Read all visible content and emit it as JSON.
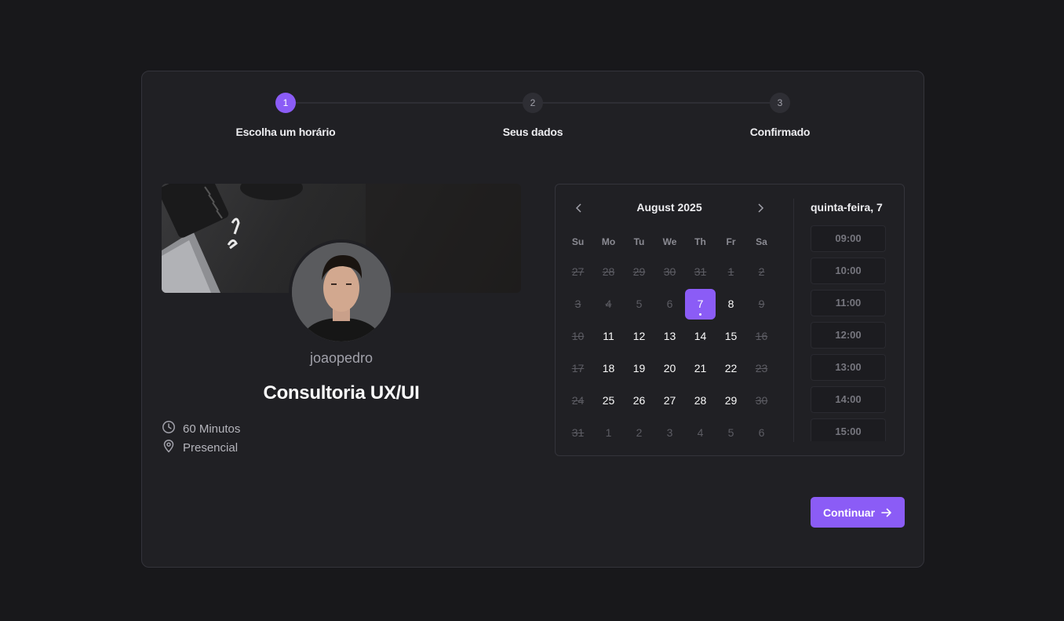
{
  "stepper": {
    "steps": [
      {
        "number": "1",
        "label": "Escolha um horário",
        "active": true
      },
      {
        "number": "2",
        "label": "Seus dados",
        "active": false
      },
      {
        "number": "3",
        "label": "Confirmado",
        "active": false
      }
    ]
  },
  "profile": {
    "username": "joaopedro",
    "service_title": "Consultoria UX/UI",
    "duration": "60 Minutos",
    "location": "Presencial"
  },
  "calendar": {
    "month_label": "August 2025",
    "weekdays": [
      "Su",
      "Mo",
      "Tu",
      "We",
      "Th",
      "Fr",
      "Sa"
    ],
    "weeks": [
      [
        {
          "d": "27",
          "s": "disabled"
        },
        {
          "d": "28",
          "s": "disabled"
        },
        {
          "d": "29",
          "s": "disabled"
        },
        {
          "d": "30",
          "s": "disabled"
        },
        {
          "d": "31",
          "s": "disabled"
        },
        {
          "d": "1",
          "s": "disabled"
        },
        {
          "d": "2",
          "s": "disabled"
        }
      ],
      [
        {
          "d": "3",
          "s": "disabled"
        },
        {
          "d": "4",
          "s": "disabled"
        },
        {
          "d": "5",
          "s": "outside"
        },
        {
          "d": "6",
          "s": "outside"
        },
        {
          "d": "7",
          "s": "selected"
        },
        {
          "d": "8",
          "s": "available"
        },
        {
          "d": "9",
          "s": "disabled"
        }
      ],
      [
        {
          "d": "10",
          "s": "disabled"
        },
        {
          "d": "11",
          "s": "available"
        },
        {
          "d": "12",
          "s": "available"
        },
        {
          "d": "13",
          "s": "available"
        },
        {
          "d": "14",
          "s": "available"
        },
        {
          "d": "15",
          "s": "available"
        },
        {
          "d": "16",
          "s": "disabled"
        }
      ],
      [
        {
          "d": "17",
          "s": "disabled"
        },
        {
          "d": "18",
          "s": "available"
        },
        {
          "d": "19",
          "s": "available"
        },
        {
          "d": "20",
          "s": "available"
        },
        {
          "d": "21",
          "s": "available"
        },
        {
          "d": "22",
          "s": "available"
        },
        {
          "d": "23",
          "s": "disabled"
        }
      ],
      [
        {
          "d": "24",
          "s": "disabled"
        },
        {
          "d": "25",
          "s": "available"
        },
        {
          "d": "26",
          "s": "available"
        },
        {
          "d": "27",
          "s": "available"
        },
        {
          "d": "28",
          "s": "available"
        },
        {
          "d": "29",
          "s": "available"
        },
        {
          "d": "30",
          "s": "disabled"
        }
      ],
      [
        {
          "d": "31",
          "s": "disabled"
        },
        {
          "d": "1",
          "s": "outside"
        },
        {
          "d": "2",
          "s": "outside"
        },
        {
          "d": "3",
          "s": "outside"
        },
        {
          "d": "4",
          "s": "outside"
        },
        {
          "d": "5",
          "s": "outside"
        },
        {
          "d": "6",
          "s": "outside"
        }
      ]
    ]
  },
  "times": {
    "date_label": "quinta-feira, 7",
    "slots": [
      "09:00",
      "10:00",
      "11:00",
      "12:00",
      "13:00",
      "14:00",
      "15:00"
    ]
  },
  "actions": {
    "continue_label": "Continuar"
  },
  "colors": {
    "accent": "#8b5cf6",
    "background": "#18181b",
    "card": "#202024"
  }
}
